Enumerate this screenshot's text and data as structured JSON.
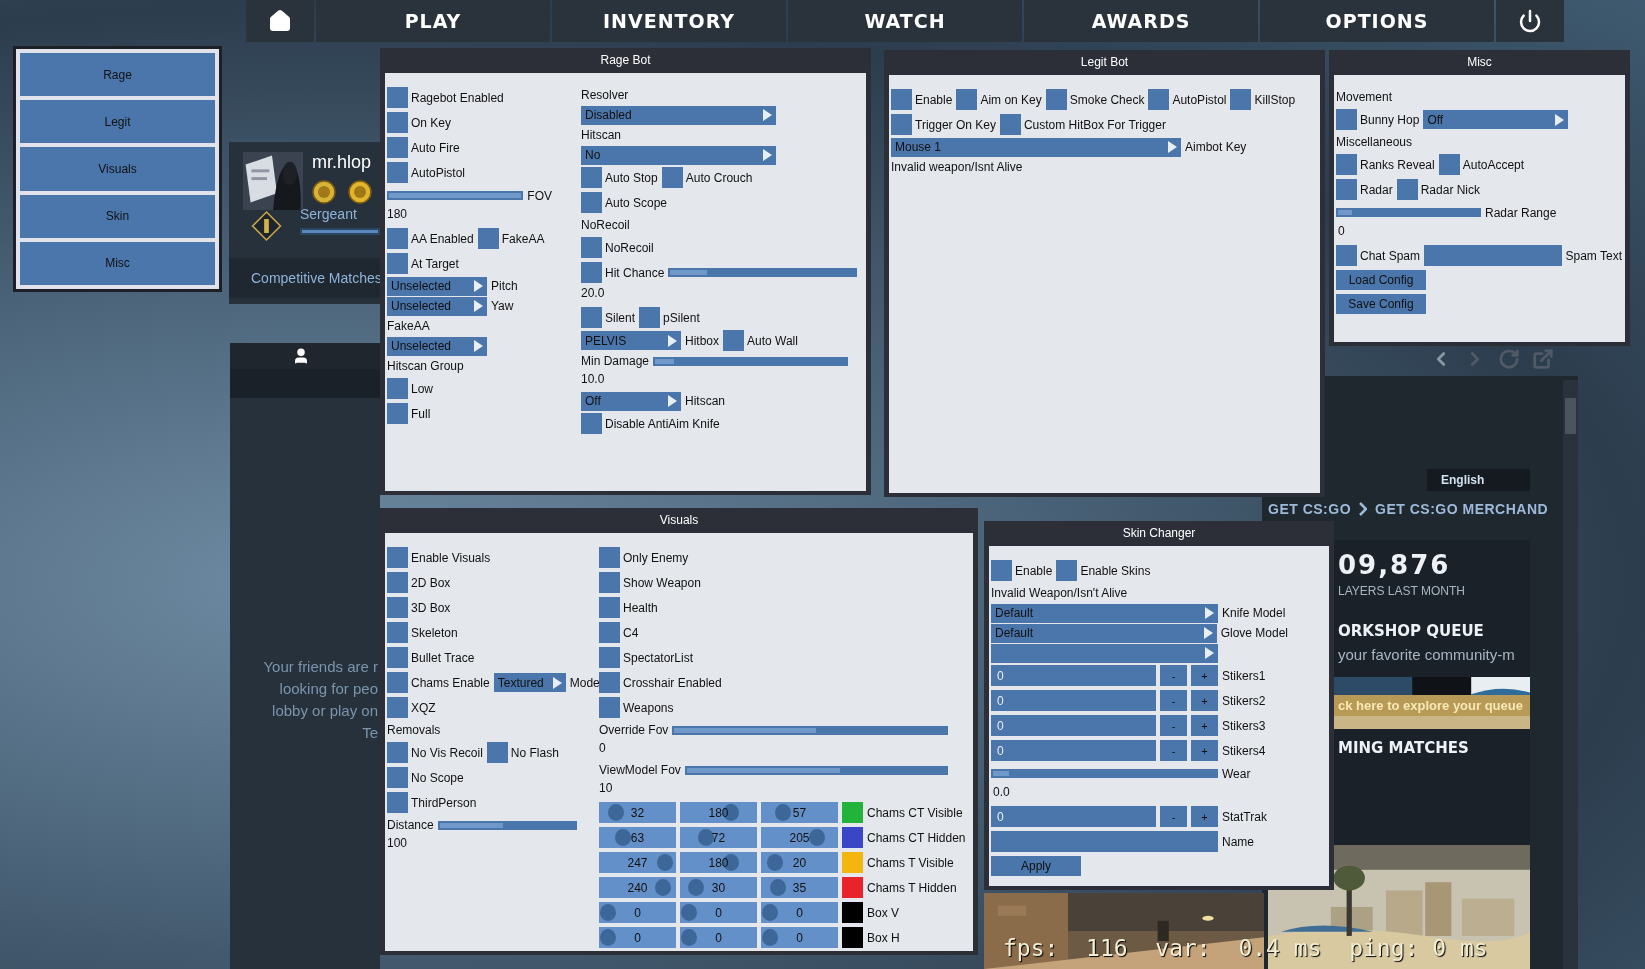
{
  "nav": {
    "items": [
      "PLAY",
      "INVENTORY",
      "WATCH",
      "AWARDS",
      "OPTIONS"
    ]
  },
  "menu": {
    "items": [
      "Rage",
      "Legit",
      "Visuals",
      "Skin",
      "Misc"
    ]
  },
  "profile": {
    "name": "mr.hlop",
    "rank": "Sergeant",
    "rank_progress": {
      "level": 1
    },
    "matches": "Competitive Matches"
  },
  "friends": {
    "message": [
      "Your friends are r",
      "looking for peo",
      "lobby or play on",
      "Te"
    ]
  },
  "news": {
    "language": "English",
    "links": [
      "GET CS:GO",
      "GET CS:GO MERCHAND"
    ],
    "player_count": "09,876",
    "player_count_label": "LAYERS LAST MONTH",
    "workshop_title": "ORKSHOP QUEUE",
    "workshop_text": "your favorite community-m",
    "workshop_link": "ck here to explore your queue",
    "matches_title": "MING MATCHES"
  },
  "net_graph": "fps:  116  var:  0.4 ms  ping: 0 ms",
  "windows": [
    {
      "title": "Rage Bot",
      "columns": [
        [
          [
            {
              "kind": "checkbox",
              "label": "Ragebot Enabled",
              "checked": false
            }
          ],
          [
            {
              "kind": "checkbox",
              "label": "On Key",
              "checked": false
            }
          ],
          [
            {
              "kind": "checkbox",
              "label": "Auto Fire",
              "checked": false
            }
          ],
          [
            {
              "kind": "checkbox",
              "label": "AutoPistol",
              "checked": false
            }
          ],
          [
            {
              "kind": "slider",
              "level": 1
            },
            {
              "kind": "label",
              "text": "FOV"
            }
          ],
          [
            {
              "kind": "reading",
              "text": "180"
            }
          ],
          [
            {
              "kind": "checkbox",
              "label": "AA Enabled",
              "checked": false
            },
            {
              "kind": "checkbox",
              "label": "FakeAA",
              "checked": false
            }
          ],
          [
            {
              "kind": "checkbox",
              "label": "At Target",
              "checked": false
            }
          ],
          [
            {
              "kind": "dropdown",
              "value": "Unselected"
            },
            {
              "kind": "label",
              "text": "Pitch"
            }
          ],
          [
            {
              "kind": "dropdown",
              "value": "Unselected"
            },
            {
              "kind": "label",
              "text": "Yaw"
            }
          ],
          [
            {
              "kind": "heading",
              "text": "FakeAA"
            }
          ],
          [
            {
              "kind": "dropdown",
              "value": "Unselected"
            }
          ],
          [
            {
              "kind": "heading",
              "text": "Hitscan Group"
            }
          ],
          [
            {
              "kind": "checkbox",
              "label": "Low",
              "checked": false
            }
          ],
          [
            {
              "kind": "checkbox",
              "label": "Full",
              "checked": false
            }
          ]
        ],
        [
          [
            {
              "kind": "heading",
              "text": "Resolver"
            }
          ],
          [
            {
              "kind": "dropdown",
              "value": "Disabled"
            }
          ],
          [
            {
              "kind": "heading",
              "text": "Hitscan"
            }
          ],
          [
            {
              "kind": "dropdown",
              "value": "No"
            }
          ],
          [
            {
              "kind": "checkbox",
              "label": "Auto Stop",
              "checked": false
            },
            {
              "kind": "checkbox",
              "label": "Auto Crouch",
              "checked": false
            }
          ],
          [
            {
              "kind": "checkbox",
              "label": "Auto Scope",
              "checked": false
            }
          ],
          [
            {
              "kind": "heading",
              "text": "NoRecoil"
            }
          ],
          [
            {
              "kind": "checkbox",
              "label": "NoRecoil",
              "checked": false
            }
          ],
          [
            {
              "kind": "checkbox",
              "label": "Hit Chance",
              "checked": false
            },
            {
              "kind": "slider",
              "level": 0.2
            }
          ],
          [
            {
              "kind": "reading",
              "text": "20.0"
            }
          ],
          [
            {
              "kind": "checkbox",
              "label": "Silent",
              "checked": false
            },
            {
              "kind": "checkbox",
              "label": "pSilent",
              "checked": false
            }
          ],
          [
            {
              "kind": "dropdown",
              "value": "PELVIS"
            },
            {
              "kind": "label",
              "text": "Hitbox"
            },
            {
              "kind": "checkbox",
              "label": "Auto Wall",
              "checked": false
            }
          ],
          [
            {
              "kind": "heading",
              "text": "Min Damage"
            },
            {
              "kind": "slider",
              "level": 0.1
            }
          ],
          [
            {
              "kind": "reading",
              "text": "10.0"
            }
          ],
          [
            {
              "kind": "dropdown",
              "value": "Off"
            },
            {
              "kind": "label",
              "text": "Hitscan"
            }
          ],
          [
            {
              "kind": "checkbox",
              "label": "Disable AntiAim Knife",
              "checked": false
            }
          ]
        ]
      ]
    },
    {
      "title": "Legit Bot",
      "columns": [
        [
          [
            {
              "kind": "checkbox",
              "label": "Enable",
              "checked": false
            },
            {
              "kind": "checkbox",
              "label": "Aim on Key",
              "checked": false
            },
            {
              "kind": "checkbox",
              "label": "Smoke Check",
              "checked": false
            },
            {
              "kind": "checkbox",
              "label": "AutoPistol",
              "checked": false
            },
            {
              "kind": "checkbox",
              "label": "KillStop",
              "checked": false
            }
          ],
          [
            {
              "kind": "checkbox",
              "label": "Trigger On Key",
              "checked": false
            },
            {
              "kind": "checkbox",
              "label": "Custom HitBox For Trigger",
              "checked": false
            }
          ],
          [
            {
              "kind": "dropdown",
              "value": "Mouse 1"
            },
            {
              "kind": "label",
              "text": "Aimbot Key"
            }
          ],
          [
            {
              "kind": "heading",
              "text": "Invalid weapon/Isnt Alive"
            }
          ]
        ]
      ]
    },
    {
      "title": "Misc",
      "columns": [
        [
          [
            {
              "kind": "heading",
              "text": "Movement"
            }
          ],
          [
            {
              "kind": "checkbox",
              "label": "Bunny Hop",
              "checked": false
            },
            {
              "kind": "dropdown",
              "value": "Off"
            }
          ],
          [
            {
              "kind": "heading",
              "text": "Miscellaneous"
            }
          ],
          [
            {
              "kind": "checkbox",
              "label": "Ranks Reveal",
              "checked": false
            },
            {
              "kind": "checkbox",
              "label": "AutoAccept",
              "checked": false
            }
          ],
          [
            {
              "kind": "checkbox",
              "label": "Radar",
              "checked": false
            },
            {
              "kind": "checkbox",
              "label": "Radar Nick",
              "checked": false
            }
          ],
          [
            {
              "kind": "slider",
              "level": 0.1
            },
            {
              "kind": "label",
              "text": "Radar Range"
            }
          ],
          [
            {
              "kind": "reading",
              "text": "0"
            }
          ],
          [
            {
              "kind": "checkbox",
              "label": "Chat Spam",
              "checked": false
            },
            {
              "kind": "field"
            },
            {
              "kind": "label",
              "text": "Spam Text"
            }
          ],
          [
            {
              "kind": "button",
              "label": "Load Config"
            }
          ],
          [
            {
              "kind": "button",
              "label": "Save Config"
            }
          ]
        ]
      ]
    },
    {
      "title": "Visuals",
      "columns": [
        [
          [
            {
              "kind": "checkbox",
              "label": "Enable Visuals",
              "checked": false
            }
          ],
          [
            {
              "kind": "checkbox",
              "label": "2D Box",
              "checked": false
            }
          ],
          [
            {
              "kind": "checkbox",
              "label": "3D Box",
              "checked": false
            }
          ],
          [
            {
              "kind": "checkbox",
              "label": "Skeleton",
              "checked": false
            }
          ],
          [
            {
              "kind": "checkbox",
              "label": "Bullet Trace",
              "checked": false
            }
          ],
          [
            {
              "kind": "checkbox",
              "label": "Chams Enable",
              "checked": false
            },
            {
              "kind": "dropdown",
              "value": "Textured"
            },
            {
              "kind": "label",
              "text": "Mode"
            }
          ],
          [
            {
              "kind": "checkbox",
              "label": "XQZ",
              "checked": false
            }
          ],
          [
            {
              "kind": "heading",
              "text": "Removals"
            }
          ],
          [
            {
              "kind": "checkbox",
              "label": "No Vis Recoil",
              "checked": false
            },
            {
              "kind": "checkbox",
              "label": "No Flash",
              "checked": false
            }
          ],
          [
            {
              "kind": "checkbox",
              "label": "No Scope",
              "checked": false
            }
          ],
          [
            {
              "kind": "checkbox",
              "label": "ThirdPerson",
              "checked": false
            }
          ],
          [
            {
              "kind": "heading",
              "text": "Distance"
            },
            {
              "kind": "slider",
              "level": 0.47
            }
          ],
          [
            {
              "kind": "reading",
              "text": "100"
            }
          ]
        ],
        [
          [
            {
              "kind": "checkbox",
              "label": "Only Enemy",
              "checked": false
            }
          ],
          [
            {
              "kind": "checkbox",
              "label": "Show Weapon",
              "checked": false
            }
          ],
          [
            {
              "kind": "checkbox",
              "label": "Health",
              "checked": false
            }
          ],
          [
            {
              "kind": "checkbox",
              "label": "C4",
              "checked": false
            }
          ],
          [
            {
              "kind": "checkbox",
              "label": "SpectatorList",
              "checked": false
            }
          ],
          [
            {
              "kind": "checkbox",
              "label": "Crosshair Enabled",
              "checked": false
            }
          ],
          [
            {
              "kind": "checkbox",
              "label": "Weapons",
              "checked": false
            }
          ],
          [
            {
              "kind": "heading",
              "text": "Override Fov"
            },
            {
              "kind": "slider",
              "level": 0.52
            }
          ],
          [
            {
              "kind": "reading",
              "text": "0"
            }
          ],
          [
            {
              "kind": "heading",
              "text": "ViewModel Fov"
            },
            {
              "kind": "slider",
              "level": 0.59
            }
          ],
          [
            {
              "kind": "reading",
              "text": "10"
            }
          ],
          [
            {
              "kind": "color_row",
              "label": "Chams CT Visible",
              "color": "#22b33a",
              "channels": [
                {
                  "value": "32",
                  "level": 0.13
                },
                {
                  "value": "180",
                  "level": 0.71
                },
                {
                  "value": "57",
                  "level": 0.22
                }
              ]
            }
          ],
          [
            {
              "kind": "color_row",
              "label": "Chams CT Hidden",
              "color": "#3a46c8",
              "channels": [
                {
                  "value": "63",
                  "level": 0.25
                },
                {
                  "value": "72",
                  "level": 0.28
                },
                {
                  "value": "205",
                  "level": 0.8
                }
              ]
            }
          ],
          [
            {
              "kind": "color_row",
              "label": "Chams T Visible",
              "color": "#f5b50f",
              "channels": [
                {
                  "value": "247",
                  "level": 0.97
                },
                {
                  "value": "180",
                  "level": 0.71
                },
                {
                  "value": "20",
                  "level": 0.08
                }
              ]
            }
          ],
          [
            {
              "kind": "color_row",
              "label": "Chams T Hidden",
              "color": "#e8232a",
              "channels": [
                {
                  "value": "240",
                  "level": 0.94
                },
                {
                  "value": "30",
                  "level": 0.12
                },
                {
                  "value": "35",
                  "level": 0.14
                }
              ]
            }
          ],
          [
            {
              "kind": "color_row",
              "label": "Box V",
              "color": "#000000",
              "channels": [
                {
                  "value": "0",
                  "level": 0
                },
                {
                  "value": "0",
                  "level": 0
                },
                {
                  "value": "0",
                  "level": 0
                }
              ]
            }
          ],
          [
            {
              "kind": "color_row",
              "label": "Box H",
              "color": "#000000",
              "channels": [
                {
                  "value": "0",
                  "level": 0
                },
                {
                  "value": "0",
                  "level": 0
                },
                {
                  "value": "0",
                  "level": 0
                }
              ]
            }
          ]
        ]
      ]
    },
    {
      "title": "Skin Changer",
      "columns": [
        [
          [
            {
              "kind": "checkbox",
              "label": "Enable",
              "checked": false
            },
            {
              "kind": "checkbox",
              "label": "Enable Skins",
              "checked": false
            }
          ],
          [
            {
              "kind": "heading",
              "text": "Invalid Weapon/Isn't Alive"
            }
          ],
          [
            {
              "kind": "dropdown",
              "value": "Default"
            },
            {
              "kind": "label",
              "text": "Knife Model"
            }
          ],
          [
            {
              "kind": "dropdown",
              "value": "Default"
            },
            {
              "kind": "label",
              "text": "Glove Model"
            }
          ],
          [
            {
              "kind": "dropdown"
            }
          ],
          [
            {
              "kind": "field",
              "value": "0"
            },
            {
              "kind": "stepper",
              "label": "-"
            },
            {
              "kind": "stepper",
              "label": "+"
            },
            {
              "kind": "label",
              "text": "Stikers1"
            }
          ],
          [
            {
              "kind": "field",
              "value": "0"
            },
            {
              "kind": "stepper",
              "label": "-"
            },
            {
              "kind": "stepper",
              "label": "+"
            },
            {
              "kind": "label",
              "text": "Stikers2"
            }
          ],
          [
            {
              "kind": "field",
              "value": "0"
            },
            {
              "kind": "stepper",
              "label": "-"
            },
            {
              "kind": "stepper",
              "label": "+"
            },
            {
              "kind": "label",
              "text": "Stikers3"
            }
          ],
          [
            {
              "kind": "field",
              "value": "0"
            },
            {
              "kind": "stepper",
              "label": "-"
            },
            {
              "kind": "stepper",
              "label": "+"
            },
            {
              "kind": "label",
              "text": "Stikers4"
            }
          ],
          [
            {
              "kind": "slider",
              "level": 0.07
            },
            {
              "kind": "label",
              "text": "Wear"
            }
          ],
          [
            {
              "kind": "reading",
              "text": "0.0"
            }
          ],
          [
            {
              "kind": "field",
              "value": "0"
            },
            {
              "kind": "stepper",
              "label": "-"
            },
            {
              "kind": "stepper",
              "label": "+"
            },
            {
              "kind": "label",
              "text": "StatTrak"
            }
          ],
          [
            {
              "kind": "field"
            },
            {
              "kind": "label",
              "text": "Name"
            }
          ],
          [
            {
              "kind": "button",
              "label": "Apply"
            }
          ]
        ]
      ]
    }
  ]
}
